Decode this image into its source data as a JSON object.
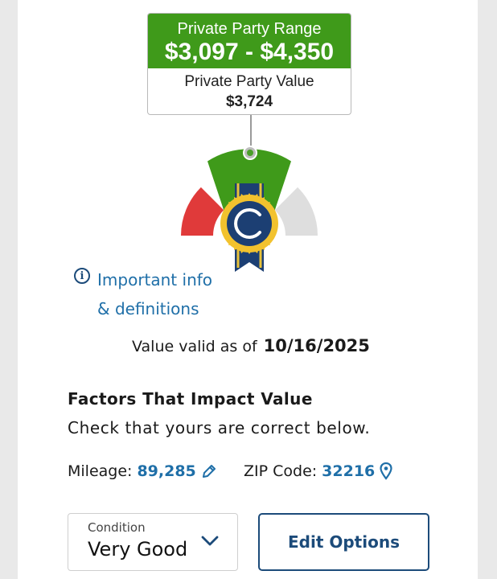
{
  "range": {
    "label": "Private Party Range",
    "value": "$3,097 - $4,350",
    "value_label": "Private Party Value",
    "value_amount": "$3,724"
  },
  "info": {
    "line1": "Important info",
    "line2": "& definitions"
  },
  "valid": {
    "label": "Value valid as of",
    "date": "10/16/2025"
  },
  "factors": {
    "title": "Factors That Impact Value",
    "subtitle": "Check that yours are correct below."
  },
  "mileage": {
    "label": "Mileage:",
    "value": "89,285"
  },
  "zip": {
    "label": "ZIP Code:",
    "value": "32216"
  },
  "condition": {
    "label": "Condition",
    "value": "Very Good"
  },
  "edit_options": {
    "label": "Edit Options"
  },
  "colors": {
    "green": "#3f9a1a",
    "red": "#e03a3a",
    "blue_link": "#1f6fa8",
    "navy": "#1c4b7a"
  }
}
